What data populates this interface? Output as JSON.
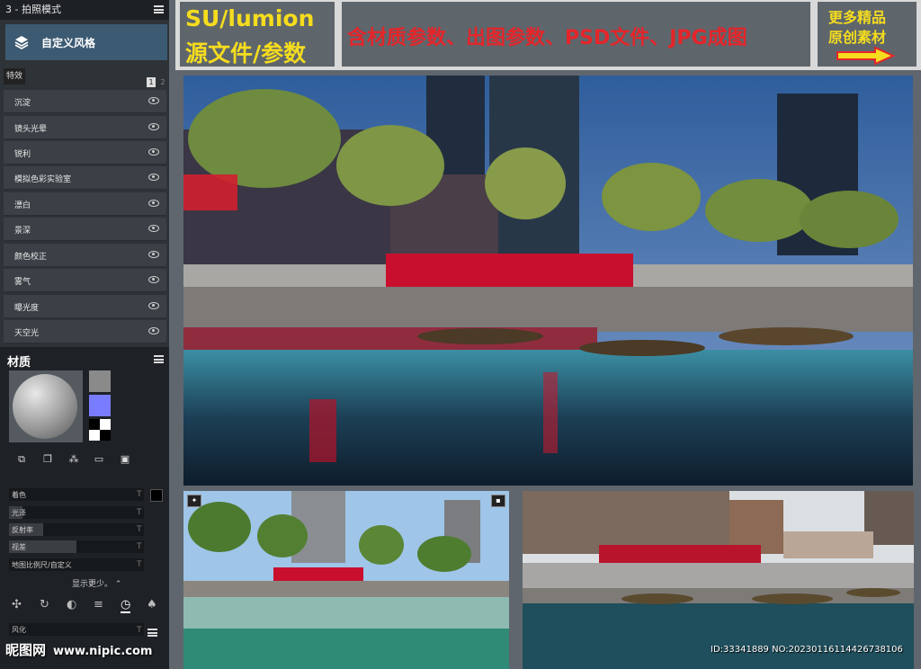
{
  "left_panel": {
    "header": "3 - 拍照模式",
    "style_card_label": "自定义风格",
    "effects_tab": "特效",
    "pages": [
      "1",
      "2"
    ],
    "effects": [
      "沉淀",
      "镜头光晕",
      "锐利",
      "模拟色彩实验室",
      "漂白",
      "景深",
      "颜色校正",
      "雾气",
      "曝光度",
      "天空光"
    ],
    "material": {
      "title": "材质",
      "swatch_colors": [
        "#8a8a8a",
        "#7a7cff"
      ],
      "properties": [
        {
          "label": "着色",
          "level": 0
        },
        {
          "label": "光泽",
          "level": 0.1
        },
        {
          "label": "反射率",
          "level": 0.25
        },
        {
          "label": "视差",
          "level": 0.5
        },
        {
          "label": "地图比例尺/自定义",
          "level": 0
        }
      ],
      "show_less": "显示更少。",
      "weathering": "风化"
    }
  },
  "banner": {
    "software_line1": "SU/lumion",
    "software_line2": "源文件/参数",
    "contents": "含材质参数、出图参数、PSD文件、JPG成图",
    "more_line1": "更多精品",
    "more_line2": "原创素材"
  },
  "watermark": {
    "brand": "昵图网",
    "url": "www.nipic.com"
  },
  "image_id": "ID:33341889 NO:20230116114426738106",
  "colors": {
    "accent_yellow": "#f5dc1e",
    "accent_red": "#e4252a",
    "panel_blue": "#3c5a72"
  }
}
